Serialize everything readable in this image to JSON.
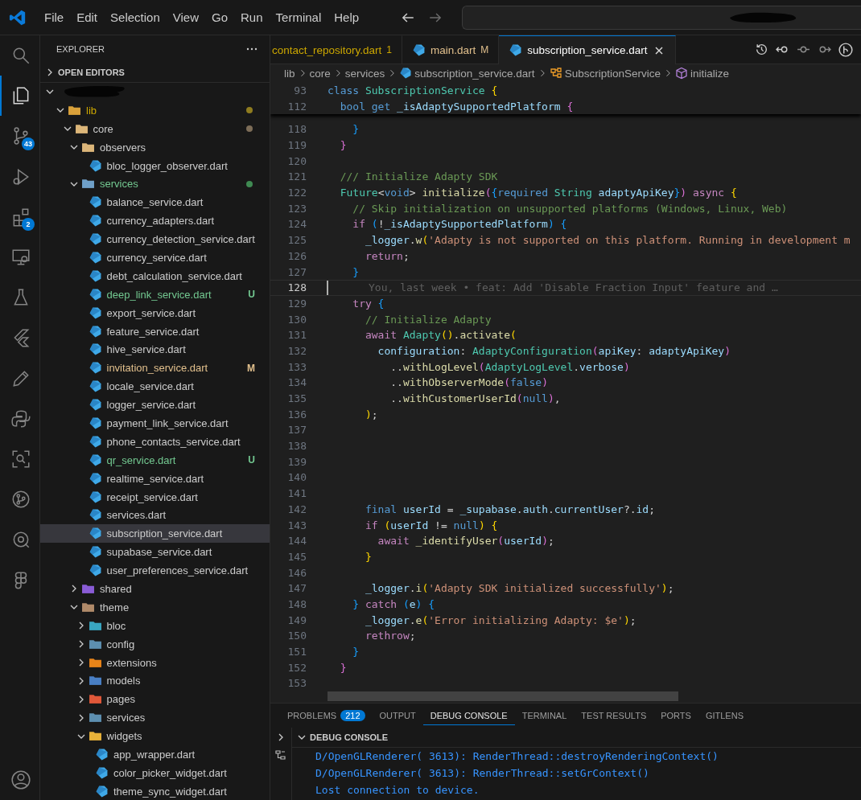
{
  "menu": [
    "File",
    "Edit",
    "Selection",
    "View",
    "Go",
    "Run",
    "Terminal",
    "Help"
  ],
  "activity_bar": [
    {
      "kind": "search",
      "selected": false
    },
    {
      "kind": "explorer",
      "selected": true
    },
    {
      "kind": "source-control",
      "selected": false,
      "badge": "43"
    },
    {
      "kind": "run-debug",
      "selected": false
    },
    {
      "kind": "extensions",
      "selected": false,
      "badge": "2"
    },
    {
      "kind": "remote",
      "selected": false
    },
    {
      "kind": "testing",
      "selected": false
    },
    {
      "kind": "flutter",
      "selected": false
    },
    {
      "kind": "pencil",
      "selected": false
    },
    {
      "kind": "python",
      "selected": false
    },
    {
      "kind": "scan",
      "selected": false
    },
    {
      "kind": "git-graph",
      "selected": false
    },
    {
      "kind": "inspect",
      "selected": false
    },
    {
      "kind": "figma",
      "selected": false
    },
    {
      "kind": "account",
      "selected": false
    }
  ],
  "sidebar": {
    "title": "EXPLORER",
    "open_editors": {
      "label": "OPEN EDITORS",
      "expanded": false
    },
    "tree": [
      {
        "kind": "folder",
        "name": "lib",
        "expanded": true,
        "problem": true,
        "color": "#d9a13b",
        "children": [
          {
            "kind": "folder",
            "name": "core",
            "expanded": true,
            "modified": true,
            "color": "#dcb67a",
            "children": [
              {
                "kind": "folder",
                "name": "observers",
                "expanded": true,
                "color": "#dcb67a",
                "children": [
                  {
                    "kind": "file",
                    "name": "bloc_logger_observer.dart",
                    "selected": false
                  }
                ]
              },
              {
                "kind": "folder",
                "name": "services",
                "expanded": true,
                "untracked": true,
                "color": "#6fa0c8",
                "children": [
                  {
                    "kind": "file",
                    "name": "balance_service.dart",
                    "selected": false
                  },
                  {
                    "kind": "file",
                    "name": "currency_adapters.dart",
                    "selected": false
                  },
                  {
                    "kind": "file",
                    "name": "currency_detection_service.dart",
                    "selected": false
                  },
                  {
                    "kind": "file",
                    "name": "currency_service.dart",
                    "selected": false
                  },
                  {
                    "kind": "file",
                    "name": "debt_calculation_service.dart",
                    "selected": false
                  },
                  {
                    "kind": "file",
                    "name": "deep_link_service.dart",
                    "selected": false,
                    "untracked": true,
                    "badge": "U"
                  },
                  {
                    "kind": "file",
                    "name": "export_service.dart",
                    "selected": false
                  },
                  {
                    "kind": "file",
                    "name": "feature_service.dart",
                    "selected": false
                  },
                  {
                    "kind": "file",
                    "name": "hive_service.dart",
                    "selected": false
                  },
                  {
                    "kind": "file",
                    "name": "invitation_service.dart",
                    "selected": false,
                    "modified": true,
                    "badge": "M"
                  },
                  {
                    "kind": "file",
                    "name": "locale_service.dart",
                    "selected": false
                  },
                  {
                    "kind": "file",
                    "name": "logger_service.dart",
                    "selected": false
                  },
                  {
                    "kind": "file",
                    "name": "payment_link_service.dart",
                    "selected": false
                  },
                  {
                    "kind": "file",
                    "name": "phone_contacts_service.dart",
                    "selected": false
                  },
                  {
                    "kind": "file",
                    "name": "qr_service.dart",
                    "selected": false,
                    "untracked": true,
                    "badge": "U"
                  },
                  {
                    "kind": "file",
                    "name": "realtime_service.dart",
                    "selected": false
                  },
                  {
                    "kind": "file",
                    "name": "receipt_service.dart",
                    "selected": false
                  },
                  {
                    "kind": "file",
                    "name": "services.dart",
                    "selected": false
                  },
                  {
                    "kind": "file",
                    "name": "subscription_service.dart",
                    "selected": true
                  },
                  {
                    "kind": "file",
                    "name": "supabase_service.dart",
                    "selected": false
                  },
                  {
                    "kind": "file",
                    "name": "user_preferences_service.dart",
                    "selected": false
                  }
                ]
              },
              {
                "kind": "folder",
                "name": "shared",
                "expanded": false,
                "color": "#8a5cd6"
              },
              {
                "kind": "folder",
                "name": "theme",
                "expanded": true,
                "color": "#b08a6a",
                "children": [
                  {
                    "kind": "folder",
                    "name": "bloc",
                    "expanded": false,
                    "color": "#3aa6c0"
                  },
                  {
                    "kind": "folder",
                    "name": "config",
                    "expanded": false,
                    "color": "#5d8fb0"
                  },
                  {
                    "kind": "folder",
                    "name": "extensions",
                    "expanded": false,
                    "color": "#e8841a"
                  },
                  {
                    "kind": "folder",
                    "name": "models",
                    "expanded": false,
                    "color": "#4a7fc4"
                  },
                  {
                    "kind": "folder",
                    "name": "pages",
                    "expanded": false,
                    "color": "#e0583a"
                  },
                  {
                    "kind": "folder",
                    "name": "services",
                    "expanded": false,
                    "color": "#5d8fb0"
                  },
                  {
                    "kind": "folder",
                    "name": "widgets",
                    "expanded": true,
                    "color": "#e8b23a",
                    "children": [
                      {
                        "kind": "file",
                        "name": "app_wrapper.dart",
                        "selected": false
                      },
                      {
                        "kind": "file",
                        "name": "color_picker_widget.dart",
                        "selected": false
                      },
                      {
                        "kind": "file",
                        "name": "theme_sync_widget.dart",
                        "selected": false
                      }
                    ]
                  }
                ]
              }
            ]
          }
        ]
      }
    ]
  },
  "tabs": [
    {
      "label": "contact_repository.dart",
      "problem": true,
      "decoration": "1",
      "selected": false
    },
    {
      "label": "main.dart",
      "modified": true,
      "decoration": "M",
      "selected": false
    },
    {
      "label": "subscription_service.dart",
      "selected": true
    }
  ],
  "breadcrumbs": [
    {
      "label": "lib",
      "kind": "folder"
    },
    {
      "label": "core",
      "kind": "folder"
    },
    {
      "label": "services",
      "kind": "folder"
    },
    {
      "label": "subscription_service.dart",
      "kind": "file"
    },
    {
      "label": "SubscriptionService",
      "kind": "class"
    },
    {
      "label": "initialize",
      "kind": "method"
    }
  ],
  "sticky_lines": [
    {
      "number": "93",
      "tokens": [
        {
          "text": "class",
          "kind": "kwb"
        },
        {
          "text": " SubscriptionService",
          "kind": "type"
        },
        {
          "text": " {",
          "kind": "p1"
        }
      ]
    },
    {
      "number": "112",
      "tokens": [
        {
          "text": "  bool",
          "kind": "kwb"
        },
        {
          "text": " get",
          "kind": "kwb"
        },
        {
          "text": " _isAdaptySupportedPlatform",
          "kind": "var"
        },
        {
          "text": " {",
          "kind": "p2"
        }
      ]
    }
  ],
  "code_lines": [
    {
      "number": "118",
      "tokens": [
        {
          "text": "    }",
          "kind": "p3"
        }
      ]
    },
    {
      "number": "119",
      "tokens": [
        {
          "text": "  }",
          "kind": "p2"
        }
      ]
    },
    {
      "number": "120"
    },
    {
      "number": "121",
      "tokens": [
        {
          "text": "  /// Initialize Adapty SDK",
          "kind": "com"
        }
      ]
    },
    {
      "number": "122",
      "tokens": [
        {
          "text": "  Future",
          "kind": "type"
        },
        {
          "text": "<",
          "kind": "plain"
        },
        {
          "text": "void",
          "kind": "kwb"
        },
        {
          "text": ">",
          "kind": "plain"
        },
        {
          "text": " initialize",
          "kind": "fn"
        },
        {
          "text": "(",
          "kind": "p2"
        },
        {
          "text": "{",
          "kind": "p3"
        },
        {
          "text": "required",
          "kind": "kwb"
        },
        {
          "text": " String",
          "kind": "type"
        },
        {
          "text": " adaptyApiKey",
          "kind": "var"
        },
        {
          "text": "}",
          "kind": "p3"
        },
        {
          "text": ")",
          "kind": "p2"
        },
        {
          "text": " async",
          "kind": "kw"
        },
        {
          "text": " {",
          "kind": "p1"
        }
      ]
    },
    {
      "number": "123",
      "tokens": [
        {
          "text": "    // Skip initialization on unsupported platforms (Windows, Linux, Web)",
          "kind": "com"
        }
      ]
    },
    {
      "number": "124",
      "tokens": [
        {
          "text": "    if",
          "kind": "kw"
        },
        {
          "text": " (",
          "kind": "p3"
        },
        {
          "text": "!",
          "kind": "plain"
        },
        {
          "text": "_isAdaptySupportedPlatform",
          "kind": "var"
        },
        {
          "text": ")",
          "kind": "p3"
        },
        {
          "text": " {",
          "kind": "p3"
        }
      ]
    },
    {
      "number": "125",
      "tokens": [
        {
          "text": "      _logger",
          "kind": "var"
        },
        {
          "text": ".",
          "kind": "plain"
        },
        {
          "text": "w",
          "kind": "fn"
        },
        {
          "text": "(",
          "kind": "p1"
        },
        {
          "text": "'Adapty is not supported on this platform. Running in development m",
          "kind": "str"
        }
      ]
    },
    {
      "number": "126",
      "tokens": [
        {
          "text": "      return",
          "kind": "kw"
        },
        {
          "text": ";",
          "kind": "plain"
        }
      ]
    },
    {
      "number": "127",
      "tokens": [
        {
          "text": "    }",
          "kind": "p3"
        }
      ]
    },
    {
      "number": "128",
      "current": true,
      "blame": "You, last week • feat: Add 'Disable Fraction Input' feature and …"
    },
    {
      "number": "129",
      "tokens": [
        {
          "text": "    try",
          "kind": "kw"
        },
        {
          "text": " {",
          "kind": "p3"
        }
      ]
    },
    {
      "number": "130",
      "tokens": [
        {
          "text": "      // Initialize Adapty",
          "kind": "com"
        }
      ]
    },
    {
      "number": "131",
      "tokens": [
        {
          "text": "      await",
          "kind": "kw"
        },
        {
          "text": " Adapty",
          "kind": "type"
        },
        {
          "text": "()",
          "kind": "p1"
        },
        {
          "text": ".",
          "kind": "plain"
        },
        {
          "text": "activate",
          "kind": "fn"
        },
        {
          "text": "(",
          "kind": "p1"
        }
      ]
    },
    {
      "number": "132",
      "tokens": [
        {
          "text": "        configuration",
          "kind": "var"
        },
        {
          "text": ": ",
          "kind": "plain"
        },
        {
          "text": "AdaptyConfiguration",
          "kind": "type"
        },
        {
          "text": "(",
          "kind": "p2"
        },
        {
          "text": "apiKey",
          "kind": "var"
        },
        {
          "text": ": ",
          "kind": "plain"
        },
        {
          "text": "adaptyApiKey",
          "kind": "var"
        },
        {
          "text": ")",
          "kind": "p2"
        }
      ]
    },
    {
      "number": "133",
      "tokens": [
        {
          "text": "          ..",
          "kind": "plain"
        },
        {
          "text": "withLogLevel",
          "kind": "fn"
        },
        {
          "text": "(",
          "kind": "p2"
        },
        {
          "text": "AdaptyLogLevel",
          "kind": "type"
        },
        {
          "text": ".",
          "kind": "plain"
        },
        {
          "text": "verbose",
          "kind": "var"
        },
        {
          "text": ")",
          "kind": "p2"
        }
      ]
    },
    {
      "number": "134",
      "tokens": [
        {
          "text": "          ..",
          "kind": "plain"
        },
        {
          "text": "withObserverMode",
          "kind": "fn"
        },
        {
          "text": "(",
          "kind": "p2"
        },
        {
          "text": "false",
          "kind": "kwb"
        },
        {
          "text": ")",
          "kind": "p2"
        }
      ]
    },
    {
      "number": "135",
      "tokens": [
        {
          "text": "          ..",
          "kind": "plain"
        },
        {
          "text": "withCustomerUserId",
          "kind": "fn"
        },
        {
          "text": "(",
          "kind": "p2"
        },
        {
          "text": "null",
          "kind": "kwb"
        },
        {
          "text": ")",
          "kind": "p2"
        },
        {
          "text": ",",
          "kind": "plain"
        }
      ]
    },
    {
      "number": "136",
      "tokens": [
        {
          "text": "      )",
          "kind": "p1"
        },
        {
          "text": ";",
          "kind": "plain"
        }
      ]
    },
    {
      "number": "137"
    },
    {
      "number": "138"
    },
    {
      "number": "139"
    },
    {
      "number": "140"
    },
    {
      "number": "141"
    },
    {
      "number": "142",
      "tokens": [
        {
          "text": "      final",
          "kind": "kwb"
        },
        {
          "text": " userId",
          "kind": "var"
        },
        {
          "text": " = ",
          "kind": "plain"
        },
        {
          "text": "_supabase",
          "kind": "var"
        },
        {
          "text": ".",
          "kind": "plain"
        },
        {
          "text": "auth",
          "kind": "var"
        },
        {
          "text": ".",
          "kind": "plain"
        },
        {
          "text": "currentUser",
          "kind": "var"
        },
        {
          "text": "?.",
          "kind": "plain"
        },
        {
          "text": "id",
          "kind": "var"
        },
        {
          "text": ";",
          "kind": "plain"
        }
      ]
    },
    {
      "number": "143",
      "tokens": [
        {
          "text": "      if",
          "kind": "kw"
        },
        {
          "text": " (",
          "kind": "p1"
        },
        {
          "text": "userId",
          "kind": "var"
        },
        {
          "text": " != ",
          "kind": "plain"
        },
        {
          "text": "null",
          "kind": "kwb"
        },
        {
          "text": ")",
          "kind": "p1"
        },
        {
          "text": " {",
          "kind": "p1"
        }
      ]
    },
    {
      "number": "144",
      "tokens": [
        {
          "text": "        await",
          "kind": "kw"
        },
        {
          "text": " _identifyUser",
          "kind": "fn"
        },
        {
          "text": "(",
          "kind": "p2"
        },
        {
          "text": "userId",
          "kind": "var"
        },
        {
          "text": ")",
          "kind": "p2"
        },
        {
          "text": ";",
          "kind": "plain"
        }
      ]
    },
    {
      "number": "145",
      "tokens": [
        {
          "text": "      }",
          "kind": "p1"
        }
      ]
    },
    {
      "number": "146"
    },
    {
      "number": "147",
      "tokens": [
        {
          "text": "      _logger",
          "kind": "var"
        },
        {
          "text": ".",
          "kind": "plain"
        },
        {
          "text": "i",
          "kind": "fn"
        },
        {
          "text": "(",
          "kind": "p1"
        },
        {
          "text": "'Adapty SDK initialized successfully'",
          "kind": "str"
        },
        {
          "text": ")",
          "kind": "p1"
        },
        {
          "text": ";",
          "kind": "plain"
        }
      ]
    },
    {
      "number": "148",
      "tokens": [
        {
          "text": "    }",
          "kind": "p3"
        },
        {
          "text": " catch",
          "kind": "kw"
        },
        {
          "text": " (",
          "kind": "p3"
        },
        {
          "text": "e",
          "kind": "var"
        },
        {
          "text": ")",
          "kind": "p3"
        },
        {
          "text": " {",
          "kind": "p3"
        }
      ]
    },
    {
      "number": "149",
      "tokens": [
        {
          "text": "      _logger",
          "kind": "var"
        },
        {
          "text": ".",
          "kind": "plain"
        },
        {
          "text": "e",
          "kind": "fn"
        },
        {
          "text": "(",
          "kind": "p1"
        },
        {
          "text": "'Error initializing Adapty: $e'",
          "kind": "str"
        },
        {
          "text": ")",
          "kind": "p1"
        },
        {
          "text": ";",
          "kind": "plain"
        }
      ]
    },
    {
      "number": "150",
      "tokens": [
        {
          "text": "      rethrow",
          "kind": "kw"
        },
        {
          "text": ";",
          "kind": "plain"
        }
      ]
    },
    {
      "number": "151",
      "tokens": [
        {
          "text": "    }",
          "kind": "p3"
        }
      ]
    },
    {
      "number": "152",
      "tokens": [
        {
          "text": "  }",
          "kind": "p2"
        }
      ]
    },
    {
      "number": "153"
    }
  ],
  "panel": {
    "tabs": [
      {
        "label": "PROBLEMS",
        "badge": "212",
        "selected": false
      },
      {
        "label": "OUTPUT",
        "selected": false
      },
      {
        "label": "DEBUG CONSOLE",
        "selected": true
      },
      {
        "label": "TERMINAL",
        "selected": false
      },
      {
        "label": "TEST RESULTS",
        "selected": false
      },
      {
        "label": "PORTS",
        "selected": false
      },
      {
        "label": "GITLENS",
        "selected": false
      }
    ],
    "section": {
      "label": "DEBUG CONSOLE",
      "expanded": true
    },
    "output": [
      "D/OpenGLRenderer( 3613): RenderThread::destroyRenderingContext()",
      "D/OpenGLRenderer( 3613): RenderThread::setGrContext()",
      "Lost connection to device."
    ]
  }
}
